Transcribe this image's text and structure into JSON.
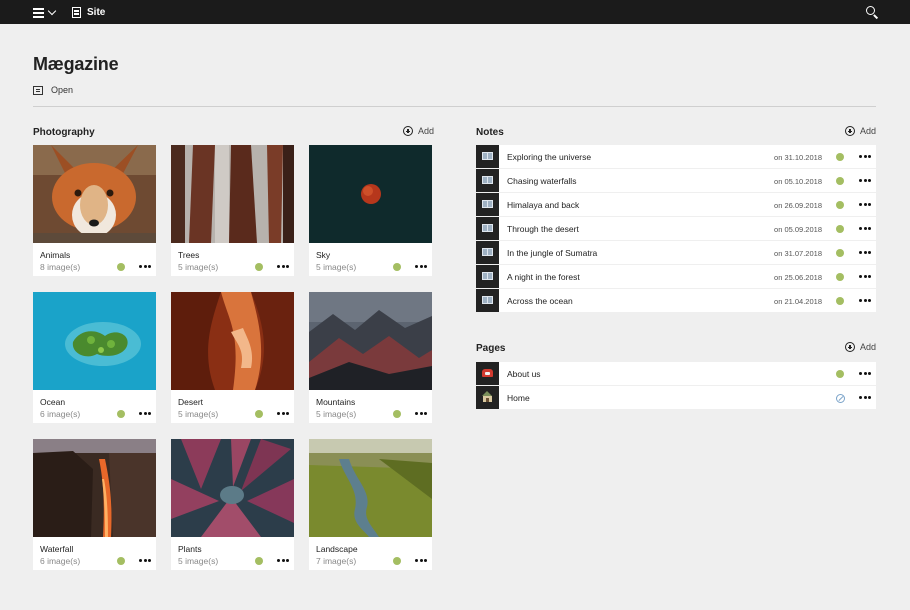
{
  "topbar": {
    "menu_icon": "hamburger-menu-icon",
    "site_label": "Site",
    "search_icon": "search-icon"
  },
  "header": {
    "title": "Mægazine",
    "open_label": "Open"
  },
  "photography": {
    "title": "Photography",
    "add_label": "Add",
    "cards": [
      {
        "name": "Animals",
        "count": "8 image(s)"
      },
      {
        "name": "Trees",
        "count": "5 image(s)"
      },
      {
        "name": "Sky",
        "count": "5 image(s)"
      },
      {
        "name": "Ocean",
        "count": "6 image(s)"
      },
      {
        "name": "Desert",
        "count": "5 image(s)"
      },
      {
        "name": "Mountains",
        "count": "5 image(s)"
      },
      {
        "name": "Waterfall",
        "count": "6 image(s)"
      },
      {
        "name": "Plants",
        "count": "5 image(s)"
      },
      {
        "name": "Landscape",
        "count": "7 image(s)"
      }
    ]
  },
  "notes": {
    "title": "Notes",
    "add_label": "Add",
    "items": [
      {
        "title": "Exploring the universe",
        "date": "on 31.10.2018"
      },
      {
        "title": "Chasing waterfalls",
        "date": "on 05.10.2018"
      },
      {
        "title": "Himalaya and back",
        "date": "on 26.09.2018"
      },
      {
        "title": "Through the desert",
        "date": "on 05.09.2018"
      },
      {
        "title": "In the jungle of Sumatra",
        "date": "on 31.07.2018"
      },
      {
        "title": "A night in the forest",
        "date": "on 25.06.2018"
      },
      {
        "title": "Across the ocean",
        "date": "on 21.04.2018"
      }
    ]
  },
  "pages": {
    "title": "Pages",
    "add_label": "Add",
    "items": [
      {
        "title": "About us",
        "icon": "telephone-icon",
        "status": "published"
      },
      {
        "title": "Home",
        "icon": "house-icon",
        "status": "unpublished"
      }
    ]
  },
  "colors": {
    "topbar": "#1b1b1b",
    "background": "#efefef",
    "status_published": "#a4be62",
    "status_unpublished": "#7aa3c9"
  }
}
